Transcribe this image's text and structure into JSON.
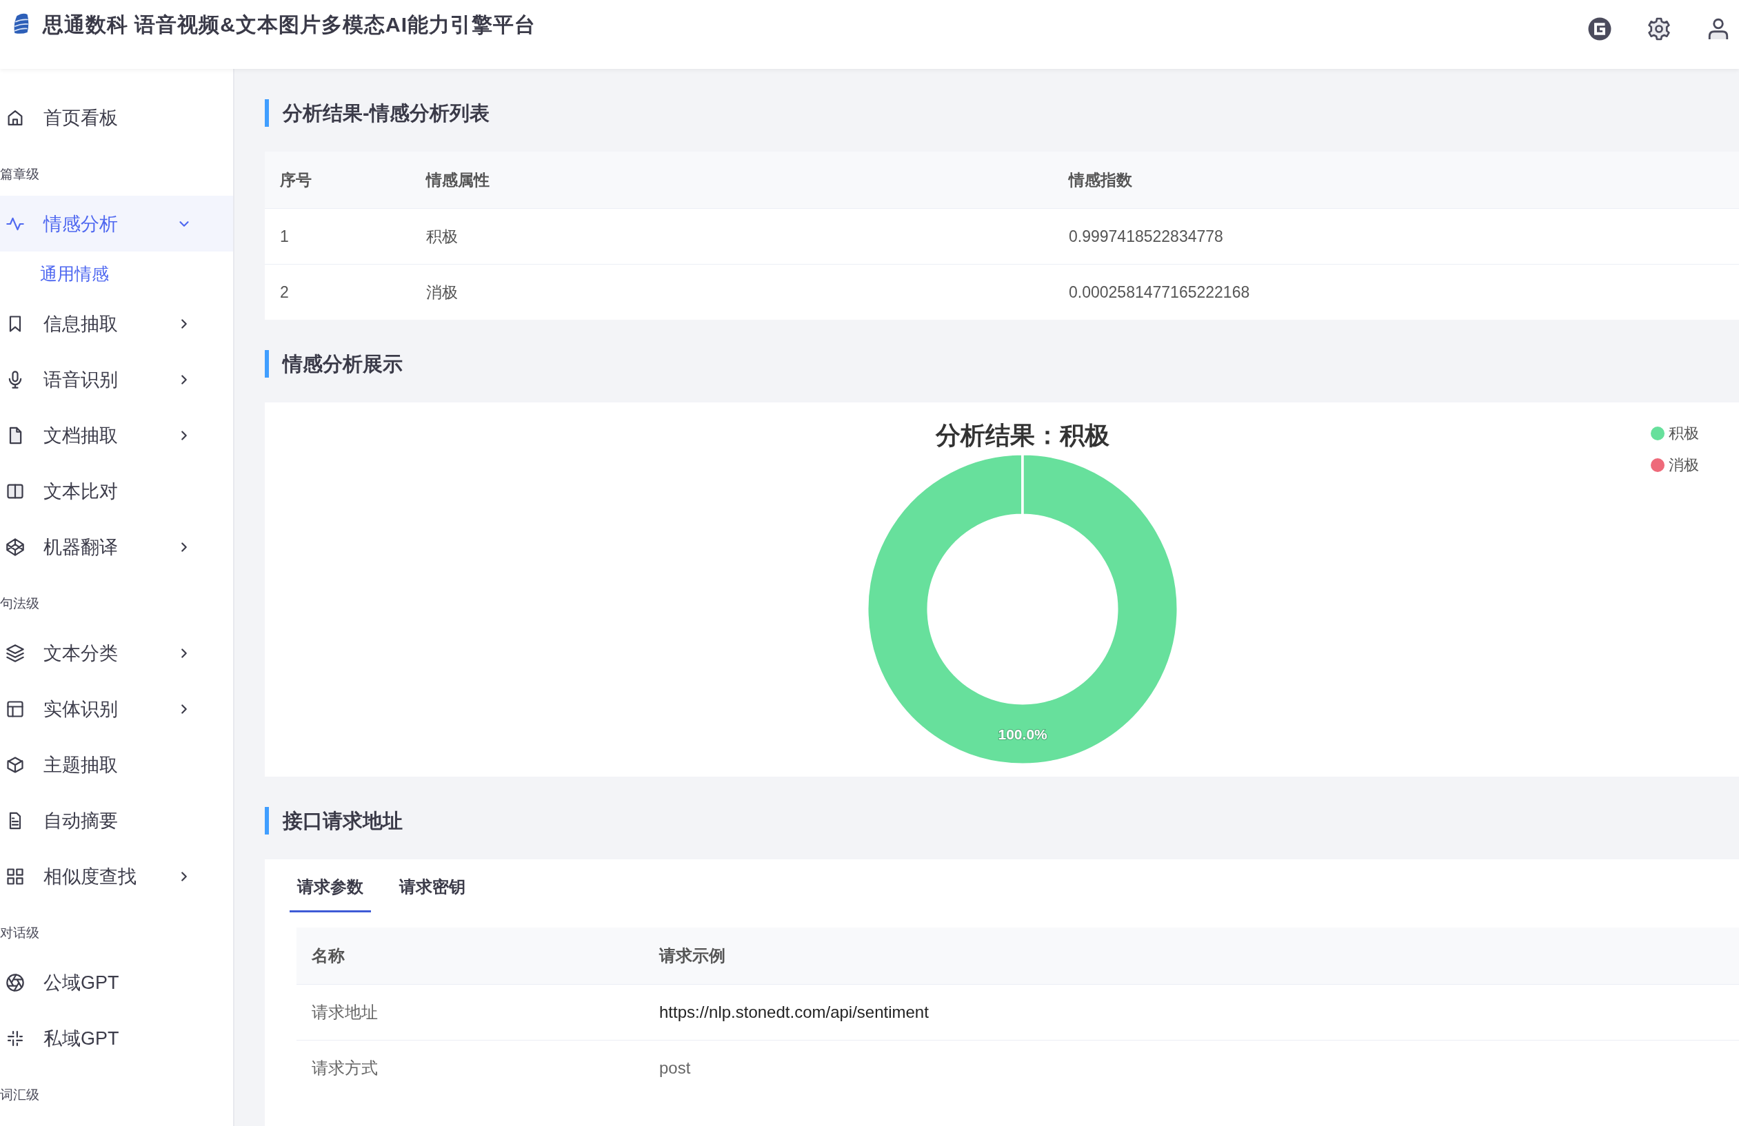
{
  "header": {
    "title": "思通数科  语音视频&文本图片多模态AI能力引擎平台"
  },
  "sidebar": {
    "items": [
      {
        "kind": "item",
        "label": "首页看板",
        "selected": false
      },
      {
        "kind": "group",
        "label": "篇章级"
      },
      {
        "kind": "item",
        "label": "情感分析",
        "selected": true,
        "expanded": true
      },
      {
        "kind": "subitem",
        "label": "通用情感",
        "selected": true
      },
      {
        "kind": "item",
        "label": "信息抽取",
        "selected": false,
        "expanded": false
      },
      {
        "kind": "item",
        "label": "语音识别",
        "selected": false,
        "expanded": false
      },
      {
        "kind": "item",
        "label": "文档抽取",
        "selected": false,
        "expanded": false
      },
      {
        "kind": "item",
        "label": "文本比对",
        "selected": false
      },
      {
        "kind": "item",
        "label": "机器翻译",
        "selected": false,
        "expanded": false
      },
      {
        "kind": "group",
        "label": "句法级"
      },
      {
        "kind": "item",
        "label": "文本分类",
        "selected": false,
        "expanded": false
      },
      {
        "kind": "item",
        "label": "实体识别",
        "selected": false,
        "expanded": false
      },
      {
        "kind": "item",
        "label": "主题抽取",
        "selected": false
      },
      {
        "kind": "item",
        "label": "自动摘要",
        "selected": false
      },
      {
        "kind": "item",
        "label": "相似度查找",
        "selected": false,
        "expanded": false
      },
      {
        "kind": "group",
        "label": "对话级"
      },
      {
        "kind": "item",
        "label": "公域GPT",
        "selected": false
      },
      {
        "kind": "item",
        "label": "私域GPT",
        "selected": false
      },
      {
        "kind": "group",
        "label": "词汇级"
      }
    ]
  },
  "results": {
    "title": "分析结果-情感分析列表",
    "columns": [
      "序号",
      "情感属性",
      "情感指数"
    ],
    "rows": [
      [
        "1",
        "积极",
        "0.9997418522834778"
      ],
      [
        "2",
        "消极",
        "0.0002581477165222168"
      ]
    ]
  },
  "display": {
    "title": "情感分析展示",
    "chart_data": {
      "type": "donut",
      "title": "分析结果：积极",
      "categories": [
        "积极",
        "消极"
      ],
      "colors": [
        "#67e09c",
        "#ee6a7a"
      ],
      "series": [
        {
          "values": [
            0.9997418522834778,
            0.0002581477165222168
          ]
        }
      ],
      "value_labels": [
        "100.0%",
        null
      ]
    }
  },
  "api": {
    "title": "接口请求地址",
    "tabs": [
      {
        "label": "请求参数",
        "selected": true
      },
      {
        "label": "请求密钥",
        "selected": false
      }
    ],
    "columns": [
      "名称",
      "请求示例"
    ],
    "rows": [
      [
        "请求地址",
        "https://nlp.stonedt.com/api/sentiment"
      ],
      [
        "请求方式",
        "post"
      ]
    ]
  }
}
